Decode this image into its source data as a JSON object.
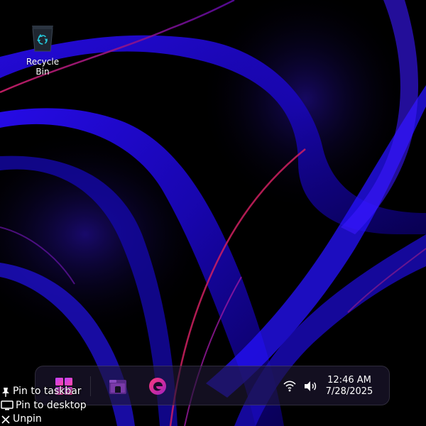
{
  "desktop": {
    "wallpaper": "swirl-wallpaper",
    "icons": [
      {
        "label_line1": "Recycle",
        "label_line2": "Bin",
        "icon": "recycle-bin-icon"
      }
    ]
  },
  "taskbar": {
    "apps": [
      {
        "name": "Start",
        "icon": "windows-start-icon"
      },
      {
        "name": "File Explorer",
        "icon": "file-explorer-icon"
      },
      {
        "name": "Microsoft Edge",
        "icon": "edge-browser-icon"
      }
    ],
    "tray": {
      "icons": [
        "wifi-icon",
        "volume-icon"
      ],
      "time": "12:46 AM",
      "date": "7/28/2025"
    }
  },
  "context_menu": {
    "items": [
      {
        "label": "Pin to taskbar",
        "icon": "pin-icon"
      },
      {
        "label": "Pin to desktop",
        "icon": "monitor-icon"
      },
      {
        "label": "Unpin",
        "icon": "close-icon"
      }
    ]
  },
  "colors": {
    "wallpaper_blue": "#1a0dff",
    "wallpaper_magenta": "#b0208a",
    "taskbar_bg": "#1e1834",
    "text": "#ffffff"
  }
}
